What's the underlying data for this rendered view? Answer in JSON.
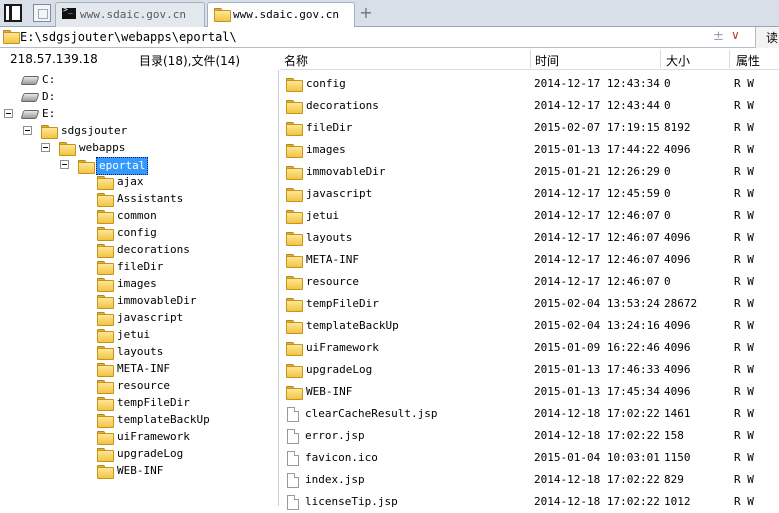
{
  "tabs": [
    {
      "label": "www.sdaic.gov.cn",
      "icon": "terminal-icon",
      "active": false
    },
    {
      "label": "www.sdaic.gov.cn",
      "icon": "folder-icon",
      "active": true
    }
  ],
  "new_tab": "+",
  "address": {
    "path": "E:\\sdgsjouter\\webapps\\eportal\\",
    "plus": "±",
    "dropdown": "∨",
    "read_button": "读"
  },
  "left": {
    "ip": "218.57.139.18",
    "stats": "目录(18),文件(14)",
    "drives": [
      "C:",
      "D:",
      "E:"
    ],
    "path_nodes": [
      "sdgsjouter",
      "webapps",
      "eportal"
    ],
    "children": [
      "ajax",
      "Assistants",
      "common",
      "config",
      "decorations",
      "fileDir",
      "images",
      "immovableDir",
      "javascript",
      "jetui",
      "layouts",
      "META-INF",
      "resource",
      "tempFileDir",
      "templateBackUp",
      "uiFramework",
      "upgradeLog",
      "WEB-INF"
    ]
  },
  "columns": {
    "name": "名称",
    "time": "时间",
    "size": "大小",
    "attr": "属性"
  },
  "files": [
    {
      "type": "folder",
      "name": "config",
      "time": "2014-12-17 12:43:34",
      "size": "0",
      "attr": "R W"
    },
    {
      "type": "folder",
      "name": "decorations",
      "time": "2014-12-17 12:43:44",
      "size": "0",
      "attr": "R W"
    },
    {
      "type": "folder",
      "name": "fileDir",
      "time": "2015-02-07 17:19:15",
      "size": "8192",
      "attr": "R W"
    },
    {
      "type": "folder",
      "name": "images",
      "time": "2015-01-13 17:44:22",
      "size": "4096",
      "attr": "R W"
    },
    {
      "type": "folder",
      "name": "immovableDir",
      "time": "2015-01-21 12:26:29",
      "size": "0",
      "attr": "R W"
    },
    {
      "type": "folder",
      "name": "javascript",
      "time": "2014-12-17 12:45:59",
      "size": "0",
      "attr": "R W"
    },
    {
      "type": "folder",
      "name": "jetui",
      "time": "2014-12-17 12:46:07",
      "size": "0",
      "attr": "R W"
    },
    {
      "type": "folder",
      "name": "layouts",
      "time": "2014-12-17 12:46:07",
      "size": "4096",
      "attr": "R W"
    },
    {
      "type": "folder",
      "name": "META-INF",
      "time": "2014-12-17 12:46:07",
      "size": "4096",
      "attr": "R W"
    },
    {
      "type": "folder",
      "name": "resource",
      "time": "2014-12-17 12:46:07",
      "size": "0",
      "attr": "R W"
    },
    {
      "type": "folder",
      "name": "tempFileDir",
      "time": "2015-02-04 13:53:24",
      "size": "28672",
      "attr": "R W"
    },
    {
      "type": "folder",
      "name": "templateBackUp",
      "time": "2015-02-04 13:24:16",
      "size": "4096",
      "attr": "R W"
    },
    {
      "type": "folder",
      "name": "uiFramework",
      "time": "2015-01-09 16:22:46",
      "size": "4096",
      "attr": "R W"
    },
    {
      "type": "folder",
      "name": "upgradeLog",
      "time": "2015-01-13 17:46:33",
      "size": "4096",
      "attr": "R W"
    },
    {
      "type": "folder",
      "name": "WEB-INF",
      "time": "2015-01-13 17:45:34",
      "size": "4096",
      "attr": "R W"
    },
    {
      "type": "file",
      "name": "clearCacheResult.jsp",
      "time": "2014-12-18 17:02:22",
      "size": "1461",
      "attr": "R W"
    },
    {
      "type": "file",
      "name": "error.jsp",
      "time": "2014-12-18 17:02:22",
      "size": "158",
      "attr": "R W"
    },
    {
      "type": "file",
      "name": "favicon.ico",
      "time": "2015-01-04 10:03:01",
      "size": "1150",
      "attr": "R W"
    },
    {
      "type": "file",
      "name": "index.jsp",
      "time": "2014-12-18 17:02:22",
      "size": "829",
      "attr": "R W"
    },
    {
      "type": "file",
      "name": "licenseTip.jsp",
      "time": "2014-12-18 17:02:22",
      "size": "1012",
      "attr": "R W"
    }
  ]
}
